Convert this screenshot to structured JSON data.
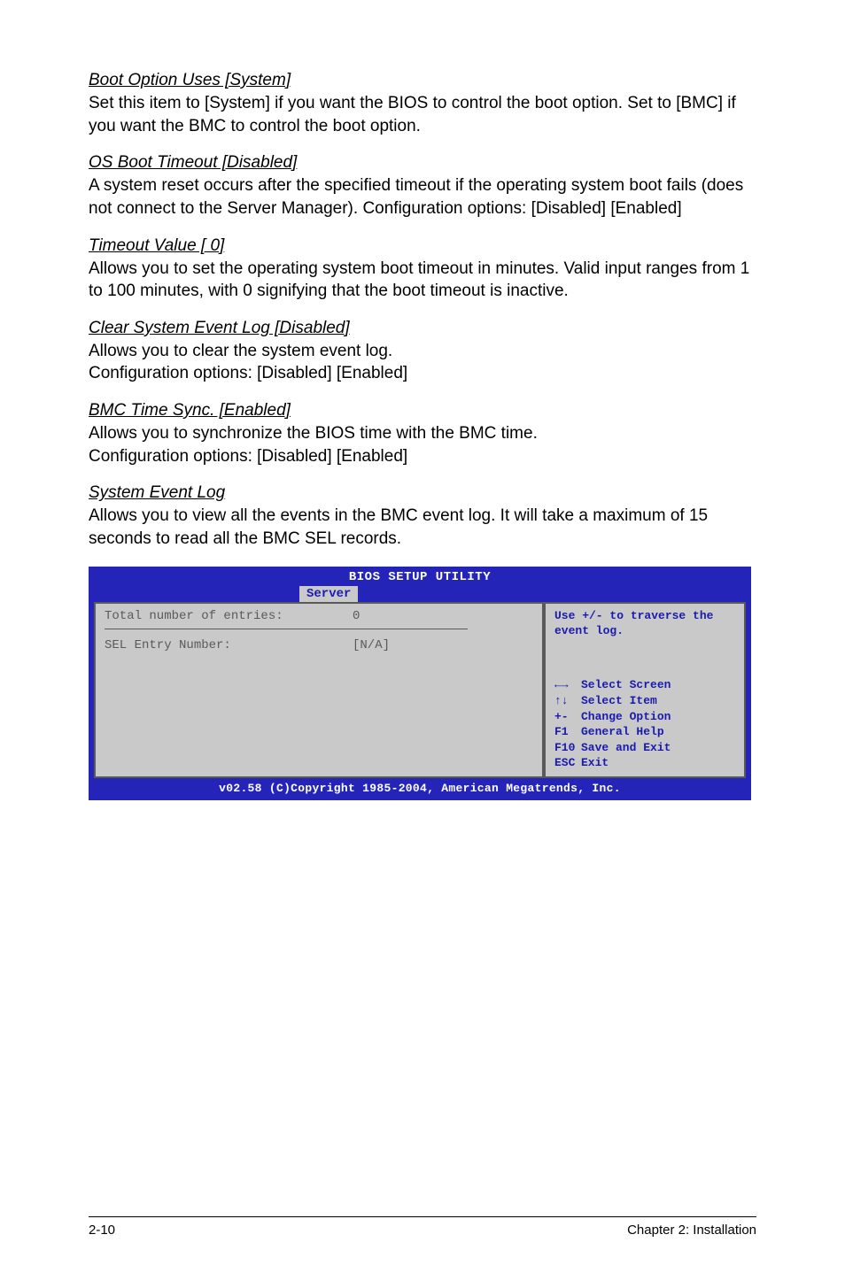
{
  "sections": [
    {
      "title": "Boot Option Uses [System]",
      "body": "Set this item to [System] if you want the BIOS to control the boot option. Set to [BMC] if you want the BMC to control the boot option."
    },
    {
      "title": "OS Boot Timeout [Disabled]",
      "body": "A system reset occurs after the specified timeout if the operating system boot fails (does not connect to the Server Manager). Configuration options: [Disabled] [Enabled]"
    },
    {
      "title": "Timeout Value [  0]",
      "body": "Allows you to set the operating system boot timeout in minutes. Valid input ranges from 1 to 100 minutes, with 0 signifying that the boot timeout is inactive."
    },
    {
      "title": "Clear System Event Log [Disabled]",
      "body": "Allows you to clear the system event log.\nConfiguration options: [Disabled] [Enabled]"
    },
    {
      "title": "BMC Time Sync. [Enabled]",
      "body": "Allows you to synchronize the BIOS time with the BMC time.\nConfiguration options: [Disabled] [Enabled]"
    },
    {
      "title": "System Event Log",
      "body": "Allows you to view all the events in the BMC event log. It will take a maximum of 15 seconds to read all the BMC SEL records."
    }
  ],
  "bios": {
    "title": "BIOS SETUP UTILITY",
    "tab": "Server",
    "left": {
      "total_label": "Total number of entries:",
      "total_value": "0",
      "sel_label": "SEL Entry Number:",
      "sel_value": "[N/A]"
    },
    "help_top": "Use +/- to traverse the event log.",
    "keys": [
      {
        "k": "←→",
        "t": "Select Screen"
      },
      {
        "k": "↑↓",
        "t": "Select Item"
      },
      {
        "k": "+-",
        "t": "Change Option"
      },
      {
        "k": "F1",
        "t": "General Help"
      },
      {
        "k": "F10",
        "t": "Save and Exit"
      },
      {
        "k": "ESC",
        "t": "Exit"
      }
    ],
    "footer": "v02.58 (C)Copyright 1985-2004, American Megatrends, Inc."
  },
  "page_footer": {
    "left": "2-10",
    "right": "Chapter 2: Installation"
  }
}
